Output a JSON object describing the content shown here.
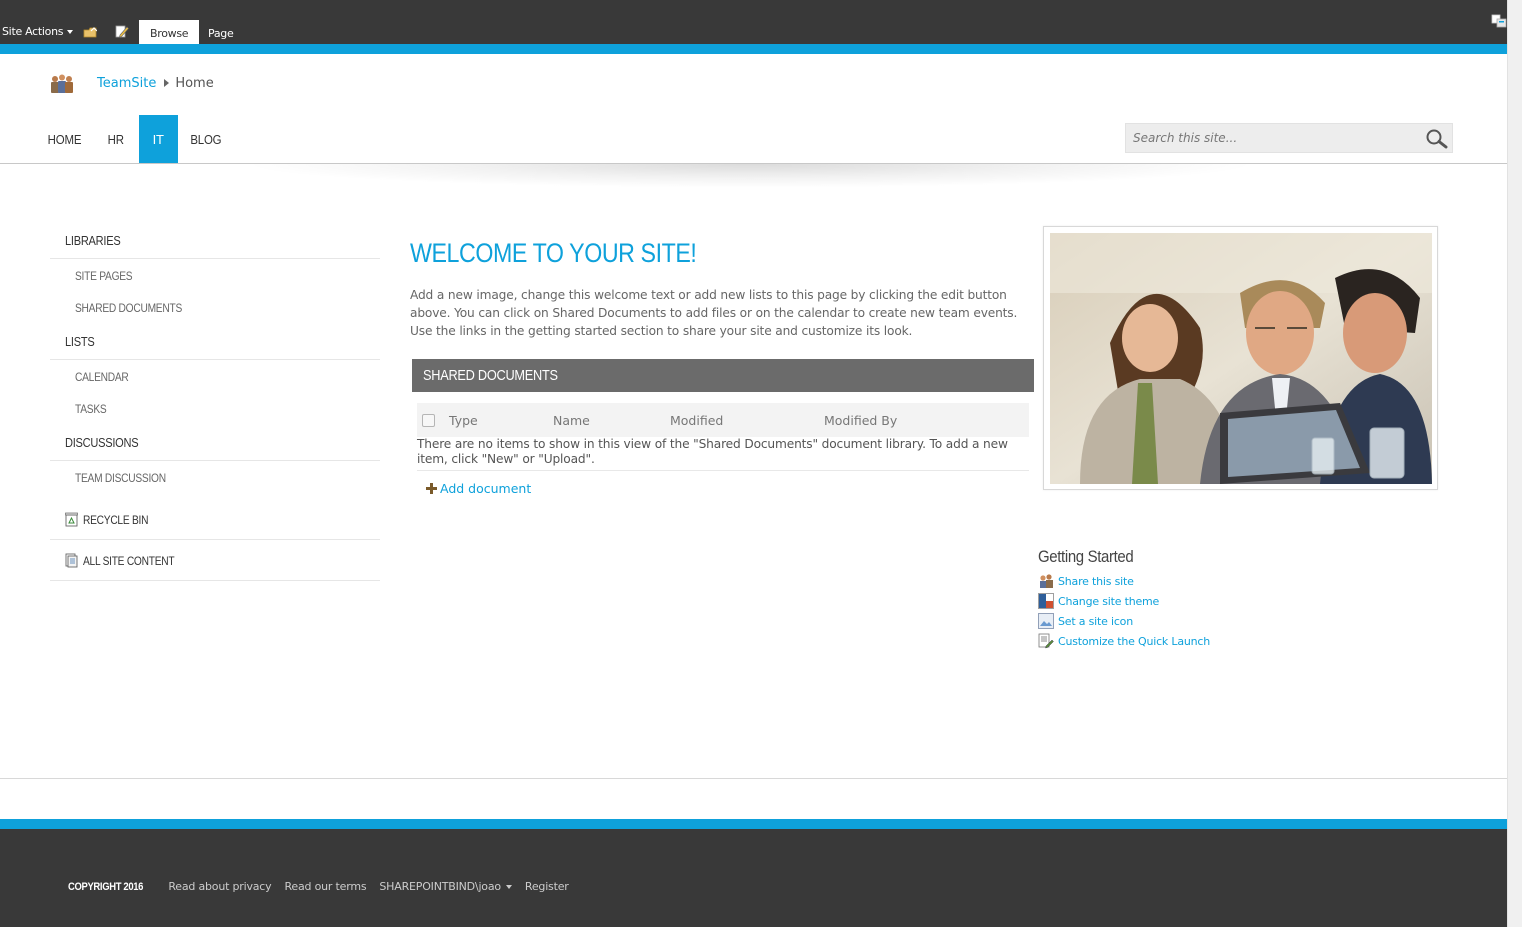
{
  "ribbon": {
    "site_actions": "Site Actions",
    "tabs": [
      {
        "label": "Browse",
        "active": true
      },
      {
        "label": "Page",
        "active": false
      }
    ]
  },
  "header": {
    "breadcrumb": [
      {
        "label": "TeamSite",
        "link": true
      },
      {
        "label": "Home",
        "link": false
      }
    ],
    "nav": [
      {
        "label": "HOME",
        "active": false
      },
      {
        "label": "HR",
        "active": false
      },
      {
        "label": "IT",
        "active": true
      },
      {
        "label": "BLOG",
        "active": false
      }
    ],
    "search_placeholder": "Search this site..."
  },
  "leftnav": {
    "libraries": "LIBRARIES",
    "site_pages": "SITE PAGES",
    "shared_documents": "SHARED DOCUMENTS",
    "lists": "LISTS",
    "calendar": "CALENDAR",
    "tasks": "TASKS",
    "discussions": "DISCUSSIONS",
    "team_discussion": "TEAM DISCUSSION",
    "recycle_bin": "RECYCLE BIN",
    "all_site_content": "ALL SITE CONTENT"
  },
  "main": {
    "title": "WELCOME TO YOUR SITE!",
    "intro": "Add a new image, change this welcome text or add new lists to this page by clicking the edit button above. You can click on Shared Documents to add files or on the calendar to create new team events. Use the links in the getting started section to share your site and customize its look.",
    "doc_header": "SHARED DOCUMENTS",
    "columns": [
      "Type",
      "Name",
      "Modified",
      "Modified By"
    ],
    "empty_message": "There are no items to show in this view of the \"Shared Documents\" document library. To add a new item, click \"New\" or \"Upload\".",
    "add_document": "Add document"
  },
  "getting_started": {
    "title": "Getting Started",
    "items": [
      {
        "label": "Share this site",
        "icon": "share-icon"
      },
      {
        "label": "Change site theme",
        "icon": "theme-icon"
      },
      {
        "label": "Set a site icon",
        "icon": "site-icon-icon"
      },
      {
        "label": "Customize the Quick Launch",
        "icon": "quick-launch-icon"
      }
    ]
  },
  "footer": {
    "copyright": "COPYRIGHT 2016",
    "privacy": "Read about privacy",
    "terms": "Read our terms",
    "user": "SHAREPOINTBIND\\joao",
    "register": "Register"
  },
  "colors": {
    "accent": "#0ea1db",
    "ribbon": "#393939",
    "doc_header": "#6b6b6b"
  }
}
